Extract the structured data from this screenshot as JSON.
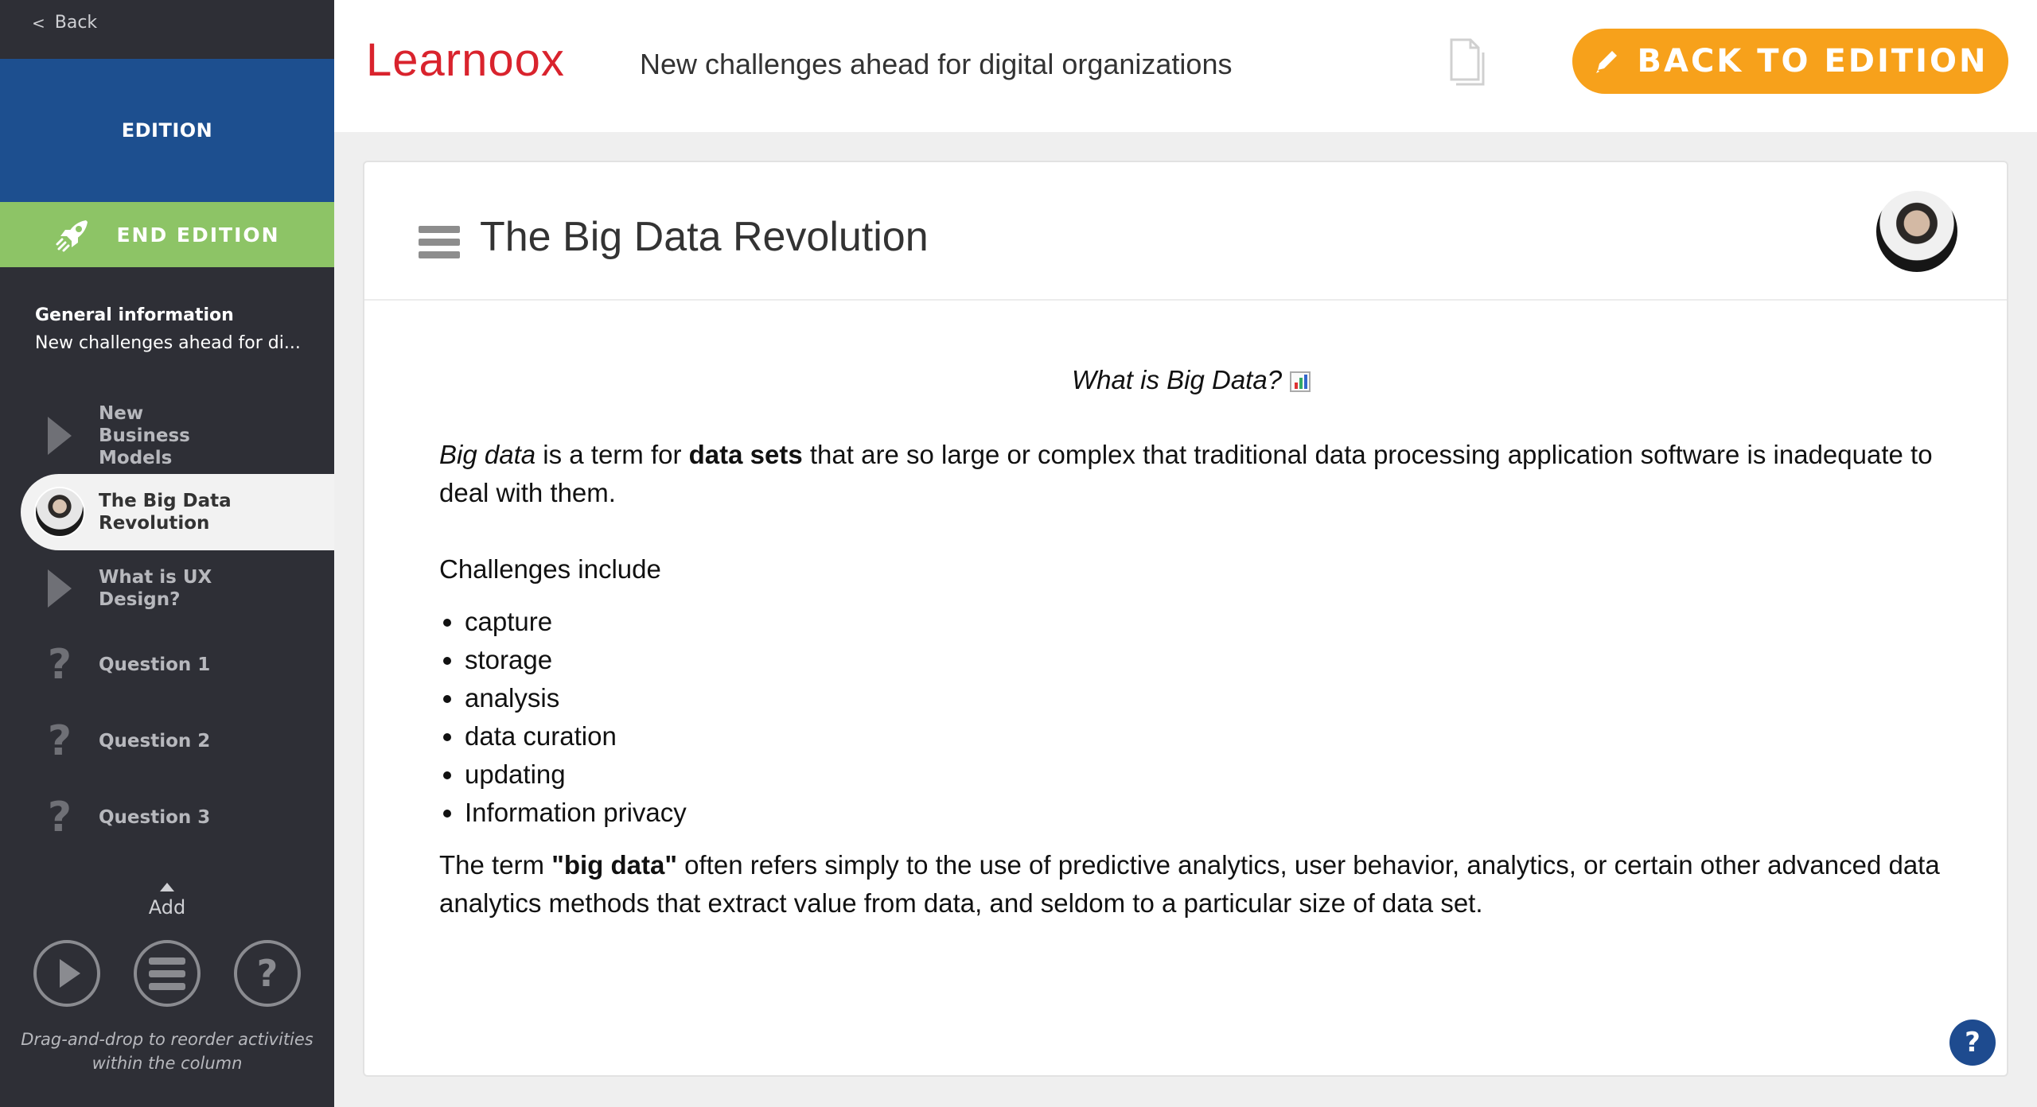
{
  "sidebar": {
    "back_label": "Back",
    "edition_label": "EDITION",
    "end_edition_label": "END EDITION",
    "general_title": "General information",
    "general_subtitle": "New challenges ahead for di...",
    "activities": [
      {
        "label": "New Business Models",
        "icon": "play-icon"
      },
      {
        "label": "The Big Data Revolution",
        "icon": "avatar"
      },
      {
        "label": "What is UX Design?",
        "icon": "play-icon"
      },
      {
        "label": "Question 1",
        "icon": "question-icon"
      },
      {
        "label": "Question 2",
        "icon": "question-icon"
      },
      {
        "label": "Question 3",
        "icon": "question-icon"
      }
    ],
    "add_label": "Add",
    "hint": "Drag-and-drop to reorder activities within the column"
  },
  "header": {
    "logo": "Learnoox",
    "title": "New challenges ahead for digital organizations",
    "back_button": "BACK TO EDITION"
  },
  "card": {
    "title": "The Big Data Revolution",
    "subtitle": "What is Big Data?",
    "p1_em": "Big data",
    "p1_a": " is a term for ",
    "p1_strong": "data sets",
    "p1_b": " that are so large or complex that traditional data processing application software is inadequate to deal with them.",
    "challenges_intro": "Challenges include",
    "challenges": [
      "capture",
      "storage",
      "analysis",
      "data curation",
      "updating",
      "Information privacy"
    ],
    "p2_a": "The term ",
    "p2_strong": "\"big data\"",
    "p2_b": " often refers simply to the use of predictive analytics, user behavior, analytics, or certain other advanced data analytics methods that extract value from data, and seldom to a particular size of data set."
  },
  "colors": {
    "sidebar_bg": "#2e2f36",
    "edition_blue": "#1d4f8f",
    "end_green": "#8dc466",
    "accent_orange": "#f7a11b",
    "logo_red": "#d9232d",
    "help_blue": "#1e4b8f"
  }
}
